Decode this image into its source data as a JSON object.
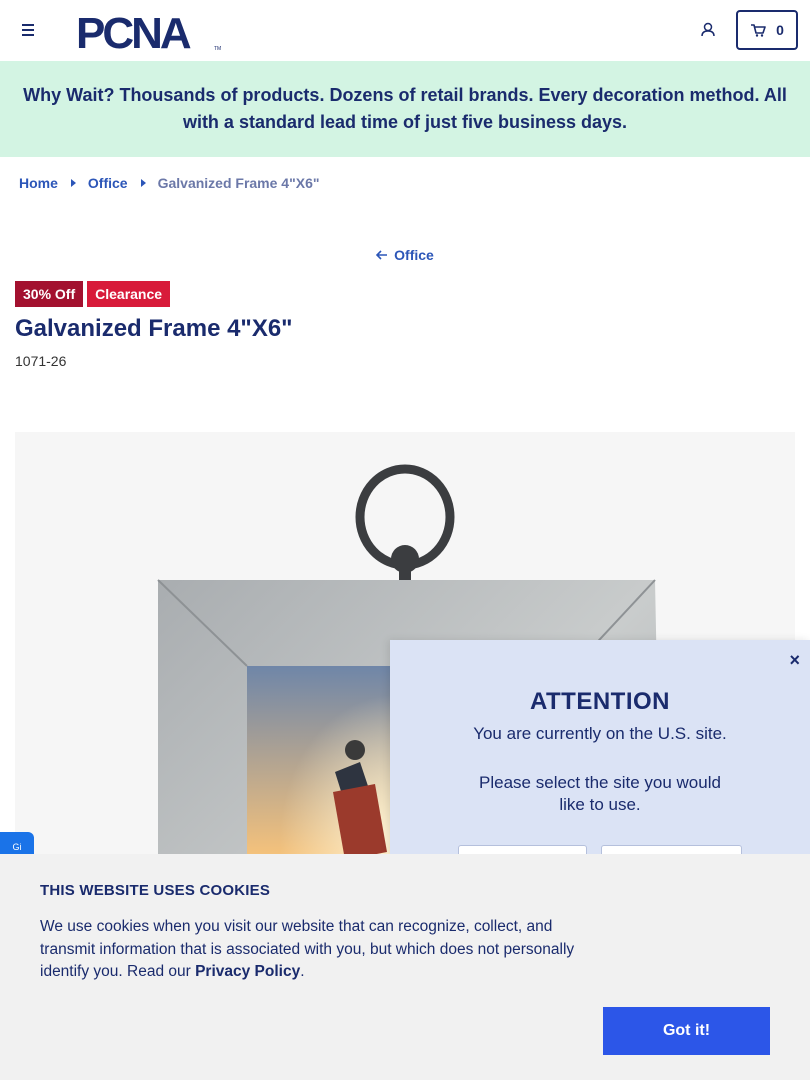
{
  "header": {
    "logo_text": "PCNA",
    "logo_tm": "TM",
    "cart_count": "0"
  },
  "promo": {
    "text": "Why Wait? Thousands of products. Dozens of retail brands. Every decoration method. All with a standard lead time of just five business days."
  },
  "breadcrumb": {
    "items": [
      {
        "label": "Home"
      },
      {
        "label": "Office"
      }
    ],
    "current": "Galvanized Frame 4\"X6\""
  },
  "back_link": {
    "label": "Office"
  },
  "product": {
    "badges": [
      "30% Off",
      "Clearance"
    ],
    "title": "Galvanized Frame 4\"X6\"",
    "sku": "1071-26"
  },
  "side_tab": {
    "label": "Gi"
  },
  "attention": {
    "close_label": "×",
    "title": "ATTENTION",
    "subtitle": "You are currently on the U.S. site.",
    "prompt": "Please select the site you would like to use."
  },
  "cookie": {
    "title": "THIS WEBSITE USES COOKIES",
    "text_before": "We use cookies when you visit our website that can recognize, collect, and transmit information that is associated with you, but which does not personally identify you. Read our ",
    "link_label": "Privacy Policy",
    "text_after": ".",
    "button_label": "Got it!"
  },
  "colors": {
    "navy": "#1a2b6d",
    "link_blue": "#2c56b8",
    "promo_bg": "#d3f4e3",
    "sale_red": "#a3112f",
    "clearance_red": "#d81b3a",
    "attention_bg": "#dbe3f5",
    "cookie_bg": "#f1f1f1",
    "button_blue": "#2c56e8"
  }
}
